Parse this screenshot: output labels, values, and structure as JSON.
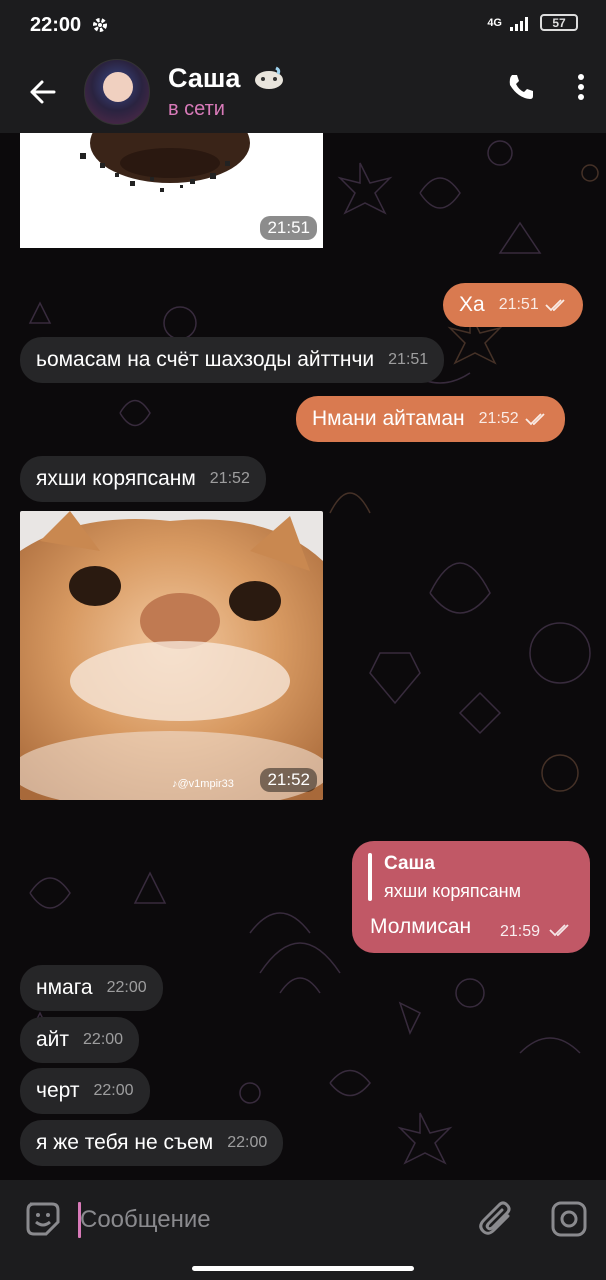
{
  "status": {
    "time": "22:00",
    "network": "4G",
    "battery": "57"
  },
  "header": {
    "name": "Саша",
    "status": "в сети"
  },
  "messages": {
    "photo1_time": "21:51",
    "m1": {
      "text": "Ха",
      "time": "21:51"
    },
    "m2": {
      "text": "ьомасам на счёт шахзоды айттнчи",
      "time": "21:51"
    },
    "m3": {
      "text": "Нмани айтаман",
      "time": "21:52"
    },
    "m4": {
      "text": "яхши коряпсанм",
      "time": "21:52"
    },
    "video": {
      "watermark": "@v1mpir33",
      "time": "21:52"
    },
    "reply": {
      "quoted_name": "Саша",
      "quoted_text": "яхши коряпсанм",
      "text": "Молмисан",
      "time": "21:59"
    },
    "m5": {
      "text": "нмага",
      "time": "22:00"
    },
    "m6": {
      "text": "айт",
      "time": "22:00"
    },
    "m7": {
      "text": "черт",
      "time": "22:00"
    },
    "m8": {
      "text": "я же тебя не съем",
      "time": "22:00"
    }
  },
  "input": {
    "placeholder": "Сообщение"
  },
  "colors": {
    "accent": "#d87ab9",
    "outgoing": "#d97a50",
    "reply_bubble": "#c15866",
    "incoming": "#262628"
  }
}
